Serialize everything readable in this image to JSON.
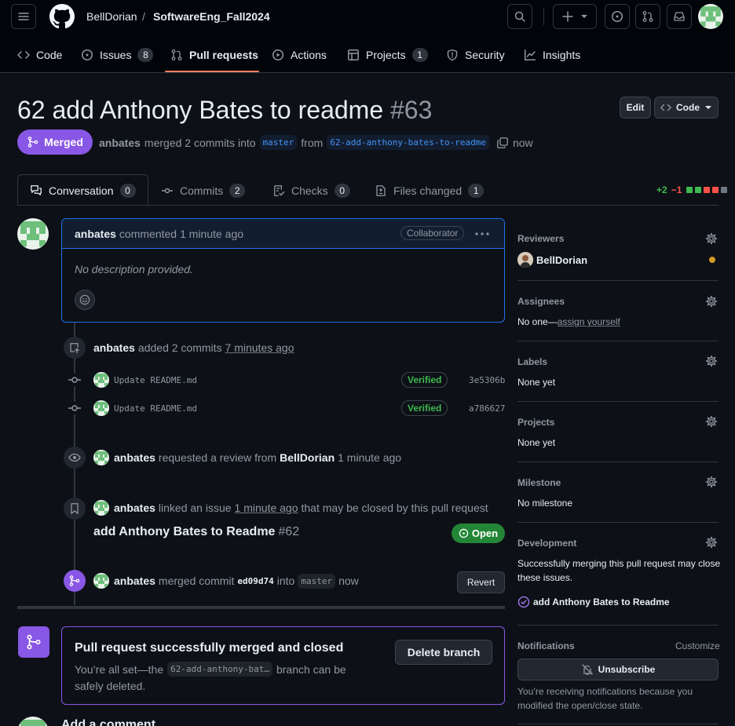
{
  "header": {
    "owner": "BellDorian",
    "separator": "/",
    "repo": "SoftwareEng_Fall2024"
  },
  "repo_nav": [
    {
      "label": "Code",
      "icon": "code-icon"
    },
    {
      "label": "Issues",
      "icon": "issue-icon",
      "count": "8"
    },
    {
      "label": "Pull requests",
      "icon": "pull-request-icon"
    },
    {
      "label": "Actions",
      "icon": "play-icon"
    },
    {
      "label": "Projects",
      "icon": "table-icon",
      "count": "1"
    },
    {
      "label": "Security",
      "icon": "shield-icon"
    },
    {
      "label": "Insights",
      "icon": "graph-icon"
    }
  ],
  "pr": {
    "title": "62 add Anthony Bates to readme",
    "number": "#63",
    "edit_label": "Edit",
    "code_label": "Code",
    "state": "Merged",
    "author": "anbates",
    "merged_text": "merged 2 commits into",
    "base": "master",
    "from_text": "from",
    "head": "62-add-anthony-bates-to-readme",
    "time": "now"
  },
  "tabs": [
    {
      "label": "Conversation",
      "count": "0"
    },
    {
      "label": "Commits",
      "count": "2"
    },
    {
      "label": "Checks",
      "count": "0"
    },
    {
      "label": "Files changed",
      "count": "1"
    }
  ],
  "diffstat": {
    "additions": "+2",
    "deletions": "−1"
  },
  "comment": {
    "author": "anbates",
    "action": "commented",
    "time": "1 minute ago",
    "role": "Collaborator",
    "body": "No description provided."
  },
  "timeline": {
    "commits_event": {
      "author": "anbates",
      "action": "added 2 commits",
      "time": "7 minutes ago"
    },
    "commits": [
      {
        "message": "Update README.md",
        "verified": "Verified",
        "sha": "3e5306b"
      },
      {
        "message": "Update README.md",
        "verified": "Verified",
        "sha": "a786627"
      }
    ],
    "review_event": {
      "author": "anbates",
      "action": "requested a review from",
      "target": "BellDorian",
      "time": "1 minute ago"
    },
    "link_event": {
      "author": "anbates",
      "action": "linked an issue",
      "time": "1 minute ago",
      "suffix": "that may be closed by this pull request"
    },
    "linked_issue": {
      "title": "add Anthony Bates to Readme",
      "number": "#62",
      "state": "Open"
    },
    "merge_event": {
      "author": "anbates",
      "action": "merged commit",
      "sha": "ed09d74",
      "into": "into",
      "branch": "master",
      "time": "now",
      "revert_label": "Revert"
    }
  },
  "merge_box": {
    "title": "Pull request successfully merged and closed",
    "line1_pre": "You’re all set—the",
    "branch": "62-add-anthony-bat…",
    "line1_post": "branch can be",
    "line2": "safely deleted.",
    "delete_label": "Delete branch"
  },
  "add_comment": {
    "title": "Add a comment"
  },
  "sidebar": {
    "reviewers": {
      "title": "Reviewers",
      "name": "BellDorian"
    },
    "assignees": {
      "title": "Assignees",
      "value": "No one—",
      "link": "assign yourself"
    },
    "labels": {
      "title": "Labels",
      "value": "None yet"
    },
    "projects": {
      "title": "Projects",
      "value": "None yet"
    },
    "milestone": {
      "title": "Milestone",
      "value": "No milestone"
    },
    "development": {
      "title": "Development",
      "text1": "Successfully merging this pull request may close",
      "text2": "these issues.",
      "issue": "add Anthony Bates to Readme"
    },
    "notifications": {
      "title": "Notifications",
      "customize": "Customize",
      "button": "Unsubscribe",
      "text1": "You’re receiving notifications because you",
      "text2": "modified the open/close state."
    }
  },
  "colors": {
    "merged": "#8957e5",
    "open": "#238636",
    "accent": "#1f6feb",
    "link": "#4493f8",
    "underline": "#f78166"
  }
}
